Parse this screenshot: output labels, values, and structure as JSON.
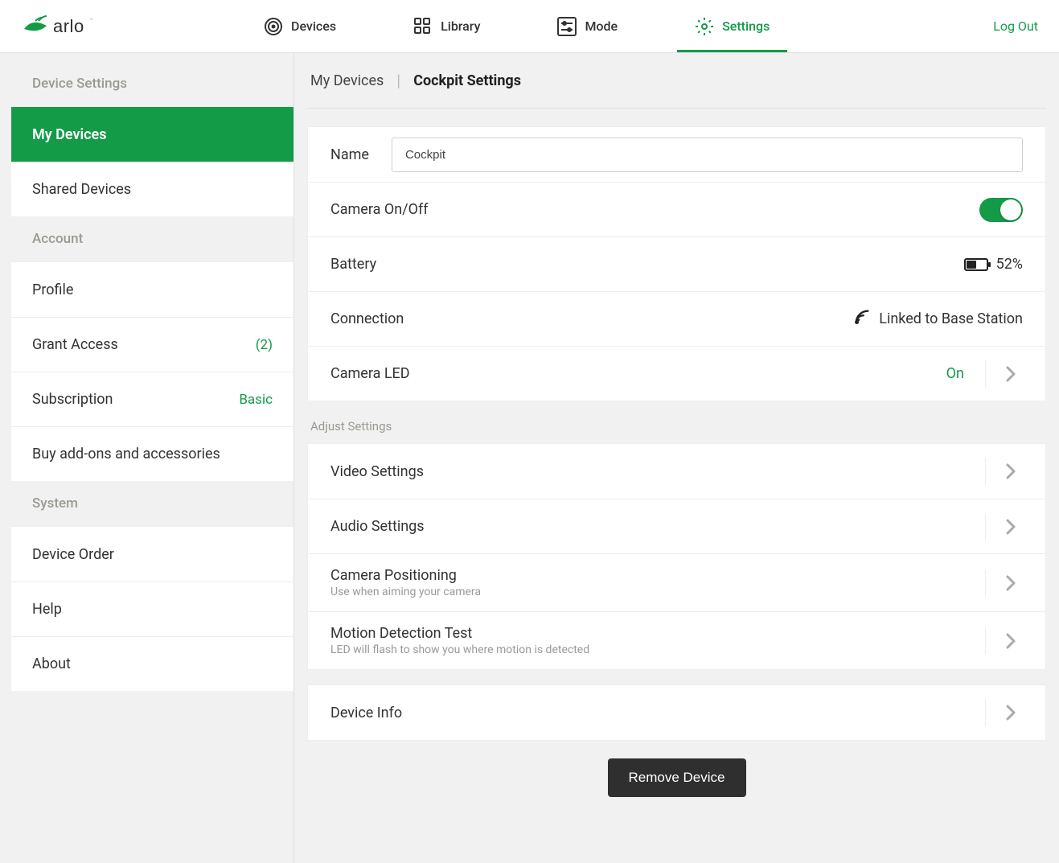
{
  "brand": "arlo",
  "nav": {
    "devices": "Devices",
    "library": "Library",
    "mode": "Mode",
    "settings": "Settings",
    "logout": "Log Out"
  },
  "sidebar": {
    "deviceSettingsHeader": "Device Settings",
    "myDevices": "My Devices",
    "sharedDevices": "Shared Devices",
    "accountHeader": "Account",
    "profile": "Profile",
    "grantAccess": "Grant Access",
    "grantAccessCount": "(2)",
    "subscription": "Subscription",
    "subscriptionPlan": "Basic",
    "addons": "Buy add-ons and accessories",
    "systemHeader": "System",
    "deviceOrder": "Device Order",
    "help": "Help",
    "about": "About"
  },
  "breadcrumb": {
    "root": "My Devices",
    "current": "Cockpit Settings"
  },
  "settings": {
    "nameLabel": "Name",
    "nameValue": "Cockpit",
    "cameraOnOff": "Camera On/Off",
    "cameraOn": true,
    "battery": "Battery",
    "batteryPct": "52%",
    "connection": "Connection",
    "connectionValue": "Linked to Base Station",
    "cameraLed": "Camera LED",
    "cameraLedValue": "On"
  },
  "adjust": {
    "header": "Adjust Settings",
    "video": "Video Settings",
    "audio": "Audio Settings",
    "positioning": "Camera Positioning",
    "positioningSub": "Use when aiming your camera",
    "motion": "Motion Detection Test",
    "motionSub": "LED will flash to show you where motion is detected"
  },
  "deviceInfo": "Device Info",
  "removeDevice": "Remove Device"
}
